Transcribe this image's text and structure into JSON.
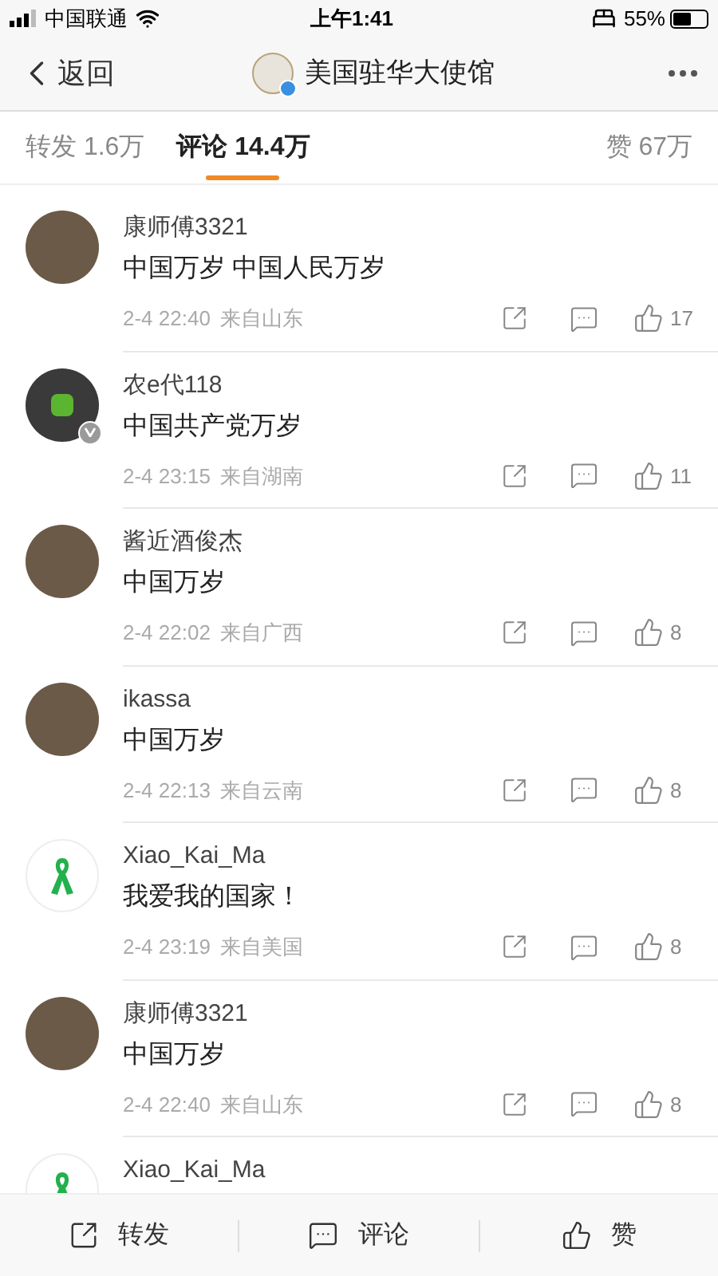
{
  "status_bar": {
    "carrier": "中国联通",
    "time": "上午1:41",
    "battery": "55%"
  },
  "nav": {
    "back": "返回",
    "title": "美国驻华大使馆",
    "verified": true
  },
  "tabs": [
    {
      "label": "转发 1.6万",
      "selected": false
    },
    {
      "label": "评论 14.4万",
      "selected": true
    },
    {
      "label": "赞 67万",
      "selected": false
    }
  ],
  "comments": [
    {
      "user": "康师傅3321",
      "kind": "photo",
      "verified": false,
      "text": "中国万岁 中国人民万岁",
      "time": "2-4 22:40",
      "location": "来自山东",
      "likes": "17"
    },
    {
      "user": "农e代118",
      "kind": "pattern",
      "verified": true,
      "text": "中国共产党万岁",
      "time": "2-4 23:15",
      "location": "来自湖南",
      "likes": "11"
    },
    {
      "user": "酱近酒俊杰",
      "kind": "photo",
      "verified": false,
      "text": "中国万岁",
      "time": "2-4 22:02",
      "location": "来自广西",
      "likes": "8"
    },
    {
      "user": "ikassa",
      "kind": "photo",
      "verified": false,
      "text": "中国万岁",
      "time": "2-4 22:13",
      "location": "来自云南",
      "likes": "8"
    },
    {
      "user": "Xiao_Kai_Ma",
      "kind": "ribbon",
      "verified": false,
      "text": "我爱我的国家！",
      "time": "2-4 23:19",
      "location": "来自美国",
      "likes": "8"
    },
    {
      "user": "康师傅3321",
      "kind": "photo",
      "verified": false,
      "text": "中国万岁",
      "time": "2-4 22:40",
      "location": "来自山东",
      "likes": "8"
    },
    {
      "user": "Xiao_Kai_Ma",
      "kind": "ribbon"
    }
  ],
  "bottom_bar": [
    {
      "kind": "repost",
      "label": "转发"
    },
    {
      "kind": "comment",
      "label": "评论"
    },
    {
      "kind": "like",
      "label": "赞"
    }
  ]
}
